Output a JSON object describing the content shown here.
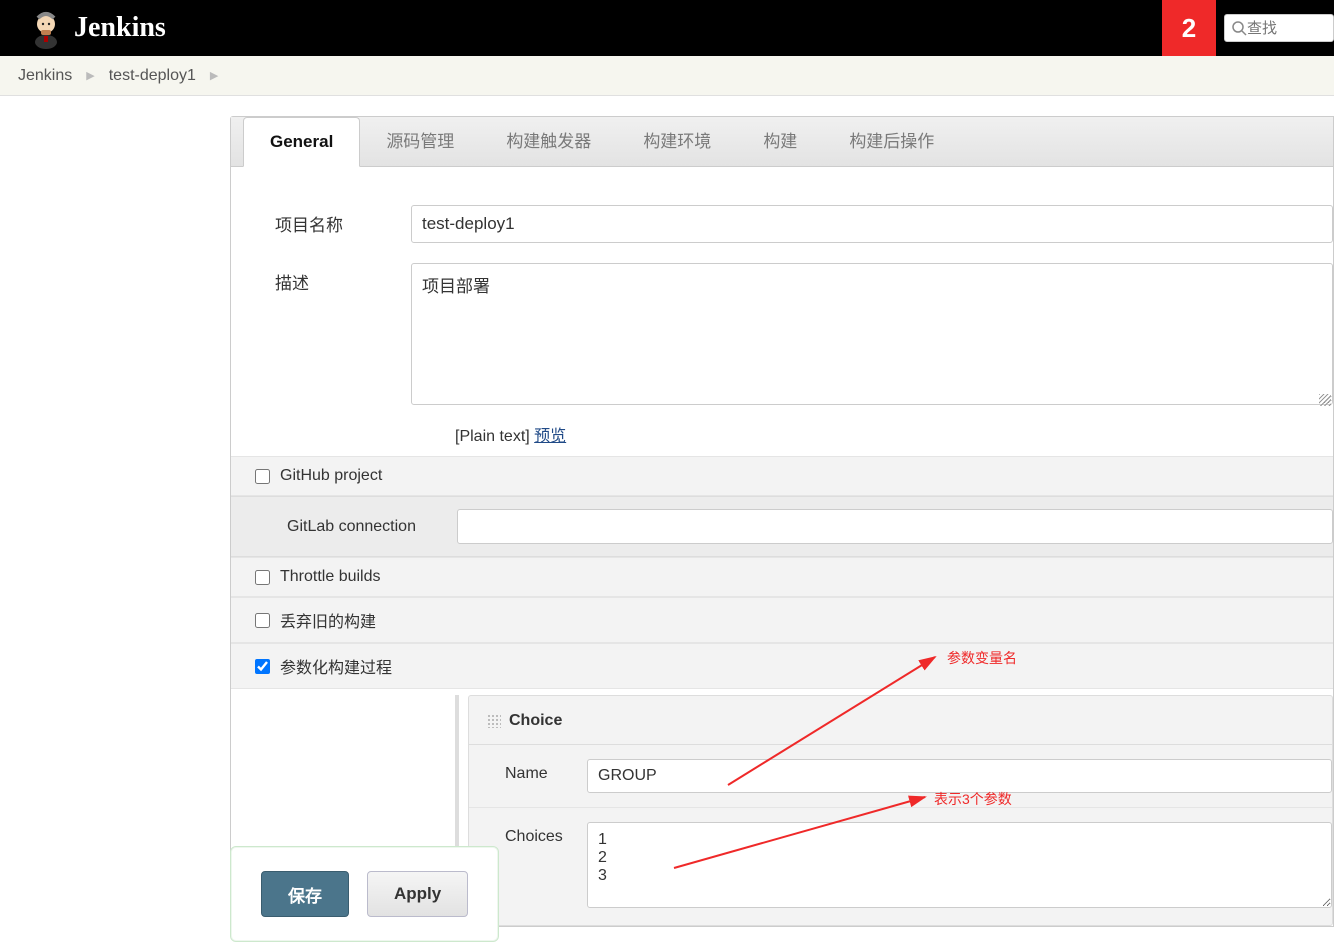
{
  "header": {
    "title": "Jenkins",
    "badge": "2",
    "search_placeholder": "查找"
  },
  "breadcrumbs": {
    "items": [
      "Jenkins",
      "test-deploy1"
    ]
  },
  "tabs": {
    "items": [
      "General",
      "源码管理",
      "构建触发器",
      "构建环境",
      "构建",
      "构建后操作"
    ],
    "active": 0
  },
  "form": {
    "project_name_label": "项目名称",
    "project_name_value": "test-deploy1",
    "description_label": "描述",
    "description_value": "项目部署",
    "plaintext_label": "[Plain text]",
    "preview_label": "预览",
    "github_project_label": "GitHub project",
    "gitlab_connection_label": "GitLab connection",
    "gitlab_connection_value": "",
    "throttle_builds_label": "Throttle builds",
    "discard_old_label": "丢弃旧的构建",
    "parameterized_label": "参数化构建过程",
    "choice": {
      "title": "Choice",
      "name_label": "Name",
      "name_value": "GROUP",
      "choices_label": "Choices",
      "choices_value": "1\n2\n3"
    }
  },
  "buttons": {
    "save": "保存",
    "apply": "Apply"
  },
  "annotations": {
    "anno1": "参数变量名",
    "anno2": "表示3个参数"
  }
}
